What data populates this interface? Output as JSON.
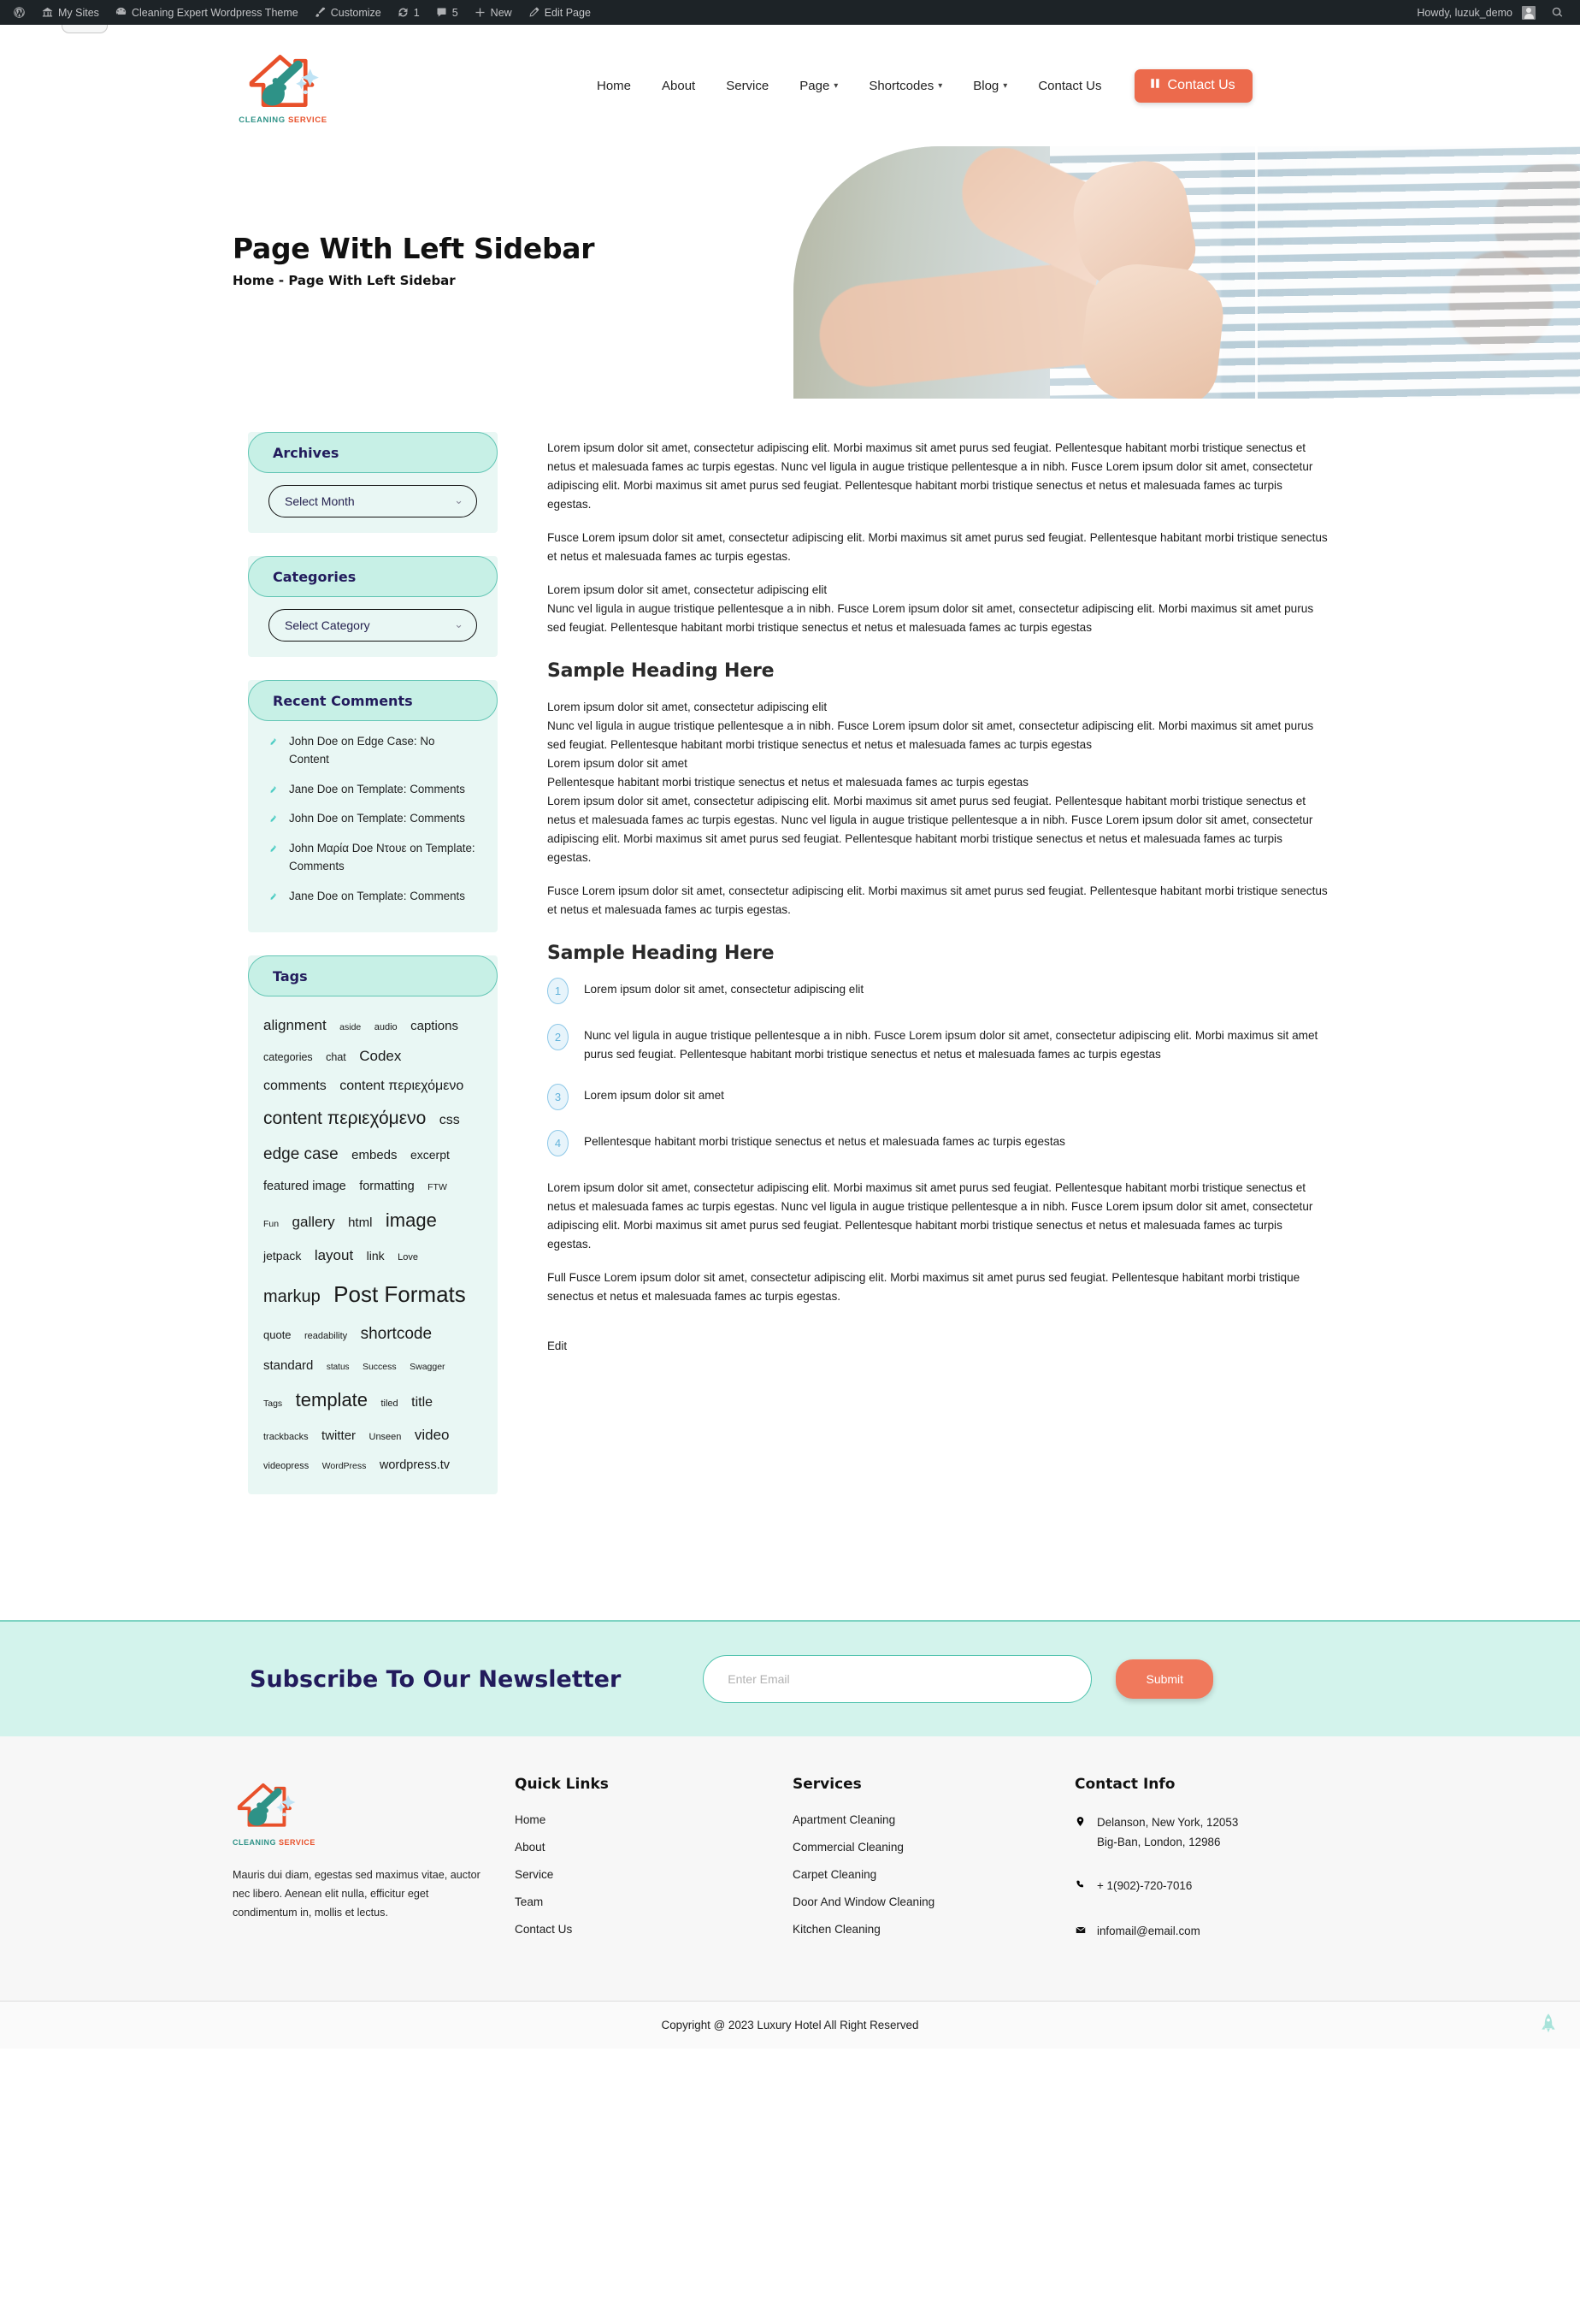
{
  "adminbar": {
    "wp_logo": "wordpress-icon",
    "items": [
      {
        "label": "My Sites",
        "icon": "sites-icon"
      },
      {
        "label": "Cleaning Expert Wordpress Theme",
        "icon": "dashboard-icon"
      },
      {
        "label": "Customize",
        "icon": "brush-icon"
      },
      {
        "label": "1",
        "icon": "updates-icon"
      },
      {
        "label": "5",
        "icon": "comments-icon"
      },
      {
        "label": "New",
        "icon": "plus-icon"
      },
      {
        "label": "Edit Page",
        "icon": "pencil-icon"
      }
    ],
    "howdy": "Howdy, luzuk_demo",
    "search_icon": "search-icon"
  },
  "header": {
    "logo": {
      "primary": "CLEANING",
      "secondary": "SERVICE",
      "icon": "house-broom-logo"
    },
    "nav": [
      {
        "label": "Home",
        "dropdown": false
      },
      {
        "label": "About",
        "dropdown": false
      },
      {
        "label": "Service",
        "dropdown": false
      },
      {
        "label": "Page",
        "dropdown": true
      },
      {
        "label": "Shortcodes",
        "dropdown": true
      },
      {
        "label": "Blog",
        "dropdown": true
      },
      {
        "label": "Contact Us",
        "dropdown": false
      }
    ],
    "cta": {
      "label": "Contact Us",
      "icon": "book-icon",
      "color": "#ec6a4c"
    }
  },
  "hero": {
    "title": "Page With Left Sidebar",
    "breadcrumb": "Home -  Page With Left Sidebar",
    "image_alt": "hands-adjusting-window-blinds"
  },
  "sidebar": {
    "archives": {
      "title": "Archives",
      "select_value": "Select Month",
      "chevron": "chevron-down-icon"
    },
    "categories": {
      "title": "Categories",
      "select_value": "Select Category",
      "chevron": "chevron-down-icon"
    },
    "recent_comments": {
      "title": "Recent Comments",
      "items": [
        "John Doe on Edge Case: No Content",
        "Jane Doe on Template: Comments",
        "John Doe on Template: Comments",
        "John Μαρία Doe Ντουε on Template: Comments",
        "Jane Doe on Template: Comments"
      ]
    },
    "tags": {
      "title": "Tags",
      "items": [
        {
          "label": "alignment",
          "size": 17
        },
        {
          "label": "aside",
          "size": 10.5
        },
        {
          "label": "audio",
          "size": 11
        },
        {
          "label": "captions",
          "size": 15
        },
        {
          "label": "categories",
          "size": 12.5
        },
        {
          "label": "chat",
          "size": 12.5
        },
        {
          "label": "Codex",
          "size": 17
        },
        {
          "label": "comments",
          "size": 16
        },
        {
          "label": "content περιεχόμενο",
          "size": 16
        },
        {
          "label": "content περιεχόμενο",
          "size": 21
        },
        {
          "label": "css",
          "size": 16
        },
        {
          "label": "edge case",
          "size": 19
        },
        {
          "label": "embeds",
          "size": 15
        },
        {
          "label": "excerpt",
          "size": 14
        },
        {
          "label": "featured image",
          "size": 14.5
        },
        {
          "label": "formatting",
          "size": 14.5
        },
        {
          "label": "FTW",
          "size": 10.5
        },
        {
          "label": "Fun",
          "size": 10.5
        },
        {
          "label": "gallery",
          "size": 17
        },
        {
          "label": "html",
          "size": 15
        },
        {
          "label": "image",
          "size": 22
        },
        {
          "label": "jetpack",
          "size": 14
        },
        {
          "label": "layout",
          "size": 17
        },
        {
          "label": "link",
          "size": 14
        },
        {
          "label": "Love",
          "size": 11
        },
        {
          "label": "markup",
          "size": 20
        },
        {
          "label": "Post Formats",
          "size": 26
        },
        {
          "label": "quote",
          "size": 13
        },
        {
          "label": "readability",
          "size": 11
        },
        {
          "label": "shortcode",
          "size": 19
        },
        {
          "label": "standard",
          "size": 15
        },
        {
          "label": "status",
          "size": 10
        },
        {
          "label": "Success",
          "size": 10.5
        },
        {
          "label": "Swagger",
          "size": 10.5
        },
        {
          "label": "Tags",
          "size": 10.5
        },
        {
          "label": "template",
          "size": 22
        },
        {
          "label": "tiled",
          "size": 11
        },
        {
          "label": "title",
          "size": 16
        },
        {
          "label": "trackbacks",
          "size": 11
        },
        {
          "label": "twitter",
          "size": 15
        },
        {
          "label": "Unseen",
          "size": 11
        },
        {
          "label": "video",
          "size": 17
        },
        {
          "label": "videopress",
          "size": 11
        },
        {
          "label": "WordPress",
          "size": 10.5
        },
        {
          "label": "wordpress.tv",
          "size": 14.5
        }
      ]
    }
  },
  "main": {
    "p1": "Lorem ipsum dolor sit amet, consectetur adipiscing elit. Morbi maximus sit amet purus sed feugiat. Pellentesque habitant morbi tristique senectus et netus et malesuada fames ac turpis egestas. Nunc vel ligula in augue tristique pellentesque a in nibh. Fusce Lorem ipsum dolor sit amet, consectetur adipiscing elit. Morbi maximus sit amet purus sed feugiat. Pellentesque habitant morbi tristique senectus et netus et malesuada fames ac turpis egestas.",
    "p2": "Fusce Lorem ipsum dolor sit amet, consectetur adipiscing elit. Morbi maximus sit amet purus sed feugiat. Pellentesque habitant morbi tristique senectus et netus et malesuada fames ac turpis egestas.",
    "p3_line1": "Lorem ipsum dolor sit amet, consectetur adipiscing elit",
    "p3_line2": "Nunc vel ligula in augue tristique pellentesque a in nibh. Fusce Lorem ipsum dolor sit amet, consectetur adipiscing elit. Morbi maximus sit amet purus sed feugiat. Pellentesque habitant morbi tristique senectus et netus et malesuada fames ac turpis egestas",
    "heading1": "Sample Heading Here",
    "p4_line1": "Lorem ipsum dolor sit amet, consectetur adipiscing elit",
    "p4_line2": "Nunc vel ligula in augue tristique pellentesque a in nibh. Fusce Lorem ipsum dolor sit amet, consectetur adipiscing elit. Morbi maximus sit amet purus sed feugiat. Pellentesque habitant morbi tristique senectus et netus et malesuada fames ac turpis egestas",
    "p4_line3": "Lorem ipsum dolor sit amet",
    "p4_line4": "Pellentesque habitant morbi tristique senectus et netus et malesuada fames ac turpis egestas",
    "p4_line5": "Lorem ipsum dolor sit amet, consectetur adipiscing elit. Morbi maximus sit amet purus sed feugiat. Pellentesque habitant morbi tristique senectus et netus et malesuada fames ac turpis egestas. Nunc vel ligula in augue tristique pellentesque a in nibh. Fusce Lorem ipsum dolor sit amet, consectetur adipiscing elit. Morbi maximus sit amet purus sed feugiat. Pellentesque habitant morbi tristique senectus et netus et malesuada fames ac turpis egestas.",
    "p5": "Fusce Lorem ipsum dolor sit amet, consectetur adipiscing elit. Morbi maximus sit amet purus sed feugiat. Pellentesque habitant morbi tristique senectus et netus et malesuada fames ac turpis egestas.",
    "heading2": "Sample Heading Here",
    "list": [
      {
        "num": "1",
        "text": "Lorem ipsum dolor sit amet, consectetur adipiscing elit"
      },
      {
        "num": "2",
        "text": "Nunc vel ligula in augue tristique pellentesque a in nibh. Fusce Lorem ipsum dolor sit amet, consectetur adipiscing elit. Morbi maximus sit amet purus sed feugiat. Pellentesque habitant morbi tristique senectus et netus et malesuada fames ac turpis egestas"
      },
      {
        "num": "3",
        "text": "Lorem ipsum dolor sit amet"
      },
      {
        "num": "4",
        "text": "Pellentesque habitant morbi tristique senectus et netus et malesuada fames ac turpis egestas"
      }
    ],
    "p6": "Lorem ipsum dolor sit amet, consectetur adipiscing elit. Morbi maximus sit amet purus sed feugiat. Pellentesque habitant morbi tristique senectus et netus et malesuada fames ac turpis egestas. Nunc vel ligula in augue tristique pellentesque a in nibh. Fusce Lorem ipsum dolor sit amet, consectetur adipiscing elit. Morbi maximus sit amet purus sed feugiat. Pellentesque habitant morbi tristique senectus et netus et malesuada fames ac turpis egestas.",
    "p7": "Full Fusce Lorem ipsum dolor sit amet, consectetur adipiscing elit. Morbi maximus sit amet purus sed feugiat. Pellentesque habitant morbi tristique senectus et netus et malesuada fames ac turpis egestas.",
    "edit": "Edit"
  },
  "newsletter": {
    "title": "Subscribe To Our Newsletter",
    "placeholder": "Enter Email",
    "submit": "Submit"
  },
  "footer": {
    "logo": {
      "primary": "CLEANING",
      "secondary": "SERVICE",
      "icon": "house-broom-logo"
    },
    "about": "Mauris dui diam, egestas sed maximus vitae, auctor nec libero. Aenean elit nulla, efficitur eget condimentum in, mollis et lectus.",
    "quick_links": {
      "title": "Quick Links",
      "items": [
        "Home",
        "About",
        "Service",
        "Team",
        "Contact Us"
      ]
    },
    "services": {
      "title": "Services",
      "items": [
        "Apartment Cleaning",
        "Commercial Cleaning",
        "Carpet Cleaning",
        "Door And Window Cleaning",
        "Kitchen Cleaning"
      ]
    },
    "contact": {
      "title": "Contact Info",
      "address_line1": "Delanson, New York, 12053",
      "address_line2": "Big-Ban, London, 12986",
      "phone": "+ 1(902)-720-7016",
      "email": "infomail@email.com",
      "address_icon": "map-pin-icon",
      "phone_icon": "phone-icon",
      "email_icon": "envelope-icon"
    }
  },
  "copyright": {
    "text": "Copyright @ 2023 Luxury Hotel All Right Reserved",
    "scroll_top_icon": "rocket-icon"
  }
}
